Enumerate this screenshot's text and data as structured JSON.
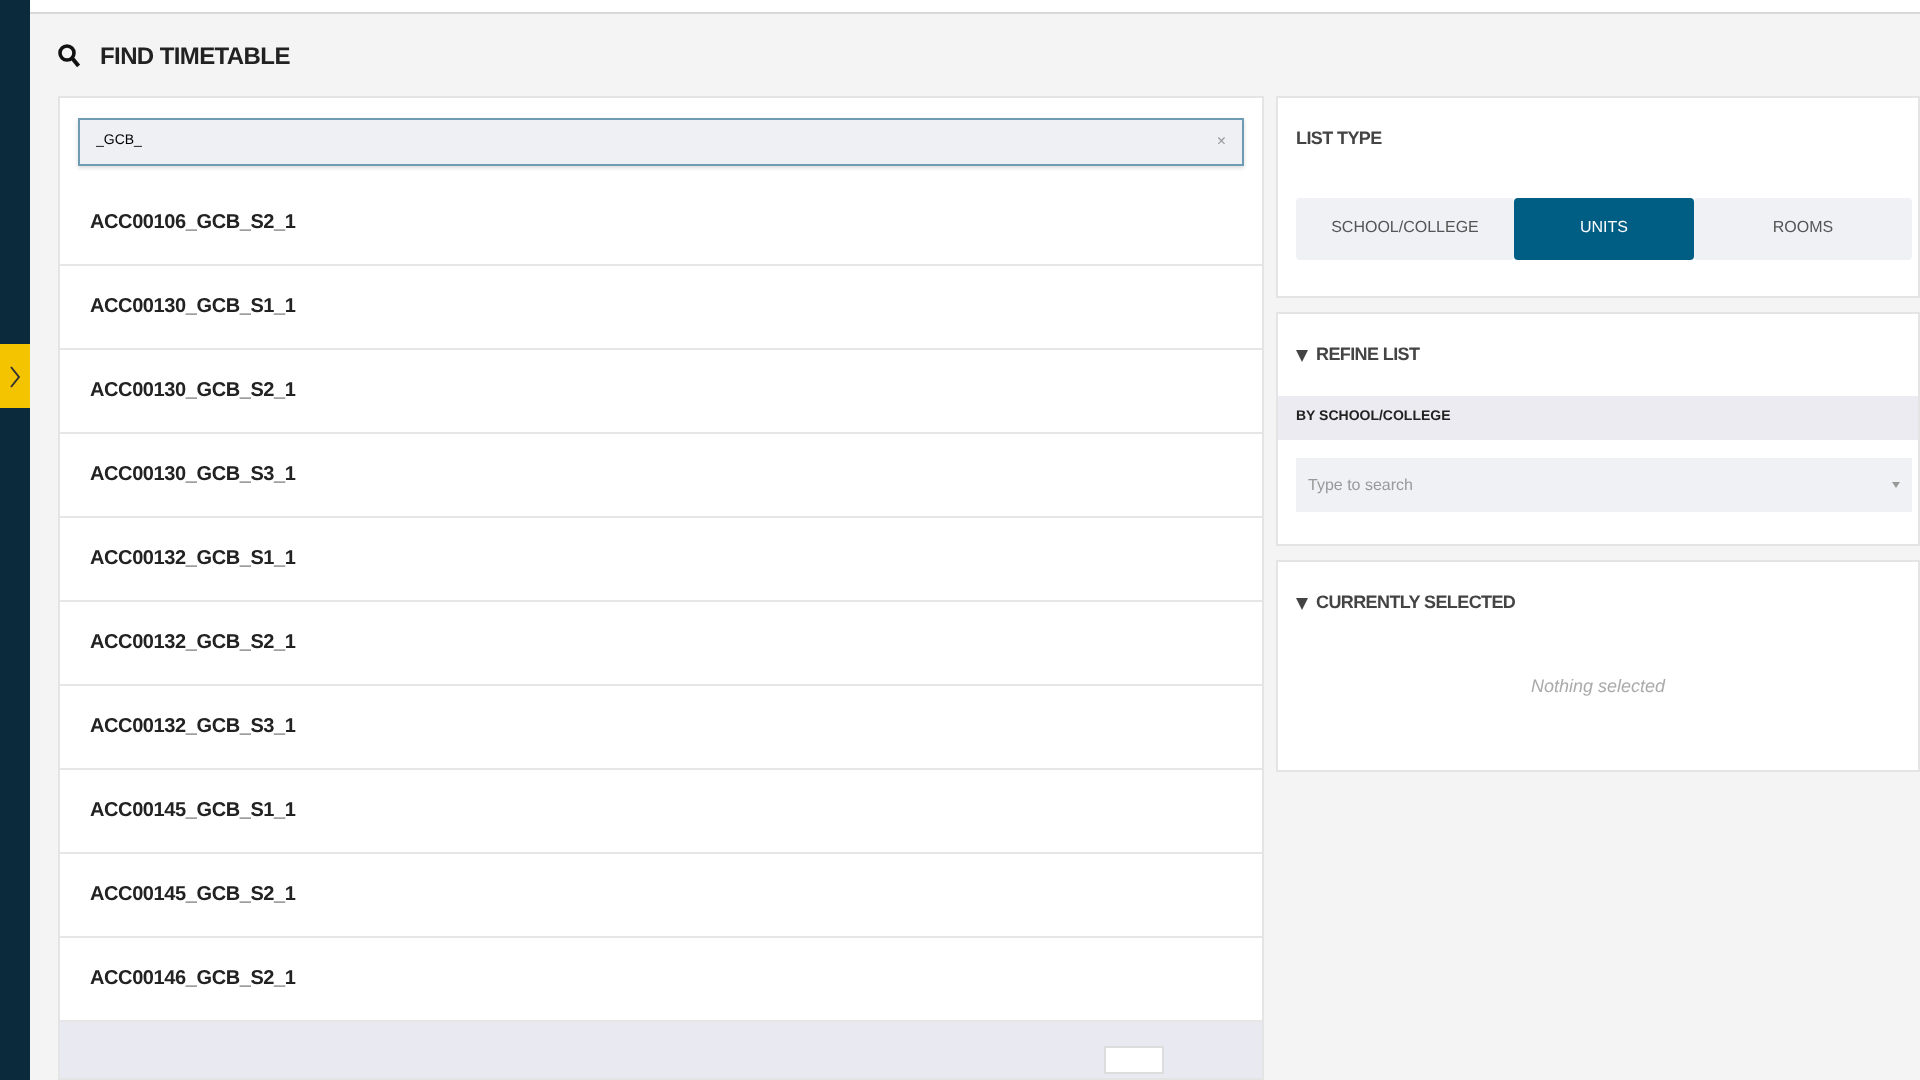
{
  "header": {
    "title": "FIND TIMETABLE"
  },
  "search": {
    "value": "_GCB_",
    "clear": "×"
  },
  "results": [
    {
      "label": "ACC00106_GCB_S2_1"
    },
    {
      "label": "ACC00130_GCB_S1_1"
    },
    {
      "label": "ACC00130_GCB_S2_1"
    },
    {
      "label": "ACC00130_GCB_S3_1"
    },
    {
      "label": "ACC00132_GCB_S1_1"
    },
    {
      "label": "ACC00132_GCB_S2_1"
    },
    {
      "label": "ACC00132_GCB_S3_1"
    },
    {
      "label": "ACC00145_GCB_S1_1"
    },
    {
      "label": "ACC00145_GCB_S2_1"
    },
    {
      "label": "ACC00146_GCB_S2_1"
    }
  ],
  "list_type": {
    "title": "LIST TYPE",
    "options": [
      {
        "label": "SCHOOL/COLLEGE",
        "selected": false
      },
      {
        "label": "UNITS",
        "selected": true
      },
      {
        "label": "ROOMS",
        "selected": false
      }
    ]
  },
  "refine": {
    "title": "REFINE LIST",
    "expanded": true,
    "filter_label": "BY SCHOOL/COLLEGE",
    "placeholder": "Type to search"
  },
  "currently_selected": {
    "title": "CURRENTLY SELECTED",
    "expanded": true,
    "empty_text": "Nothing selected"
  }
}
